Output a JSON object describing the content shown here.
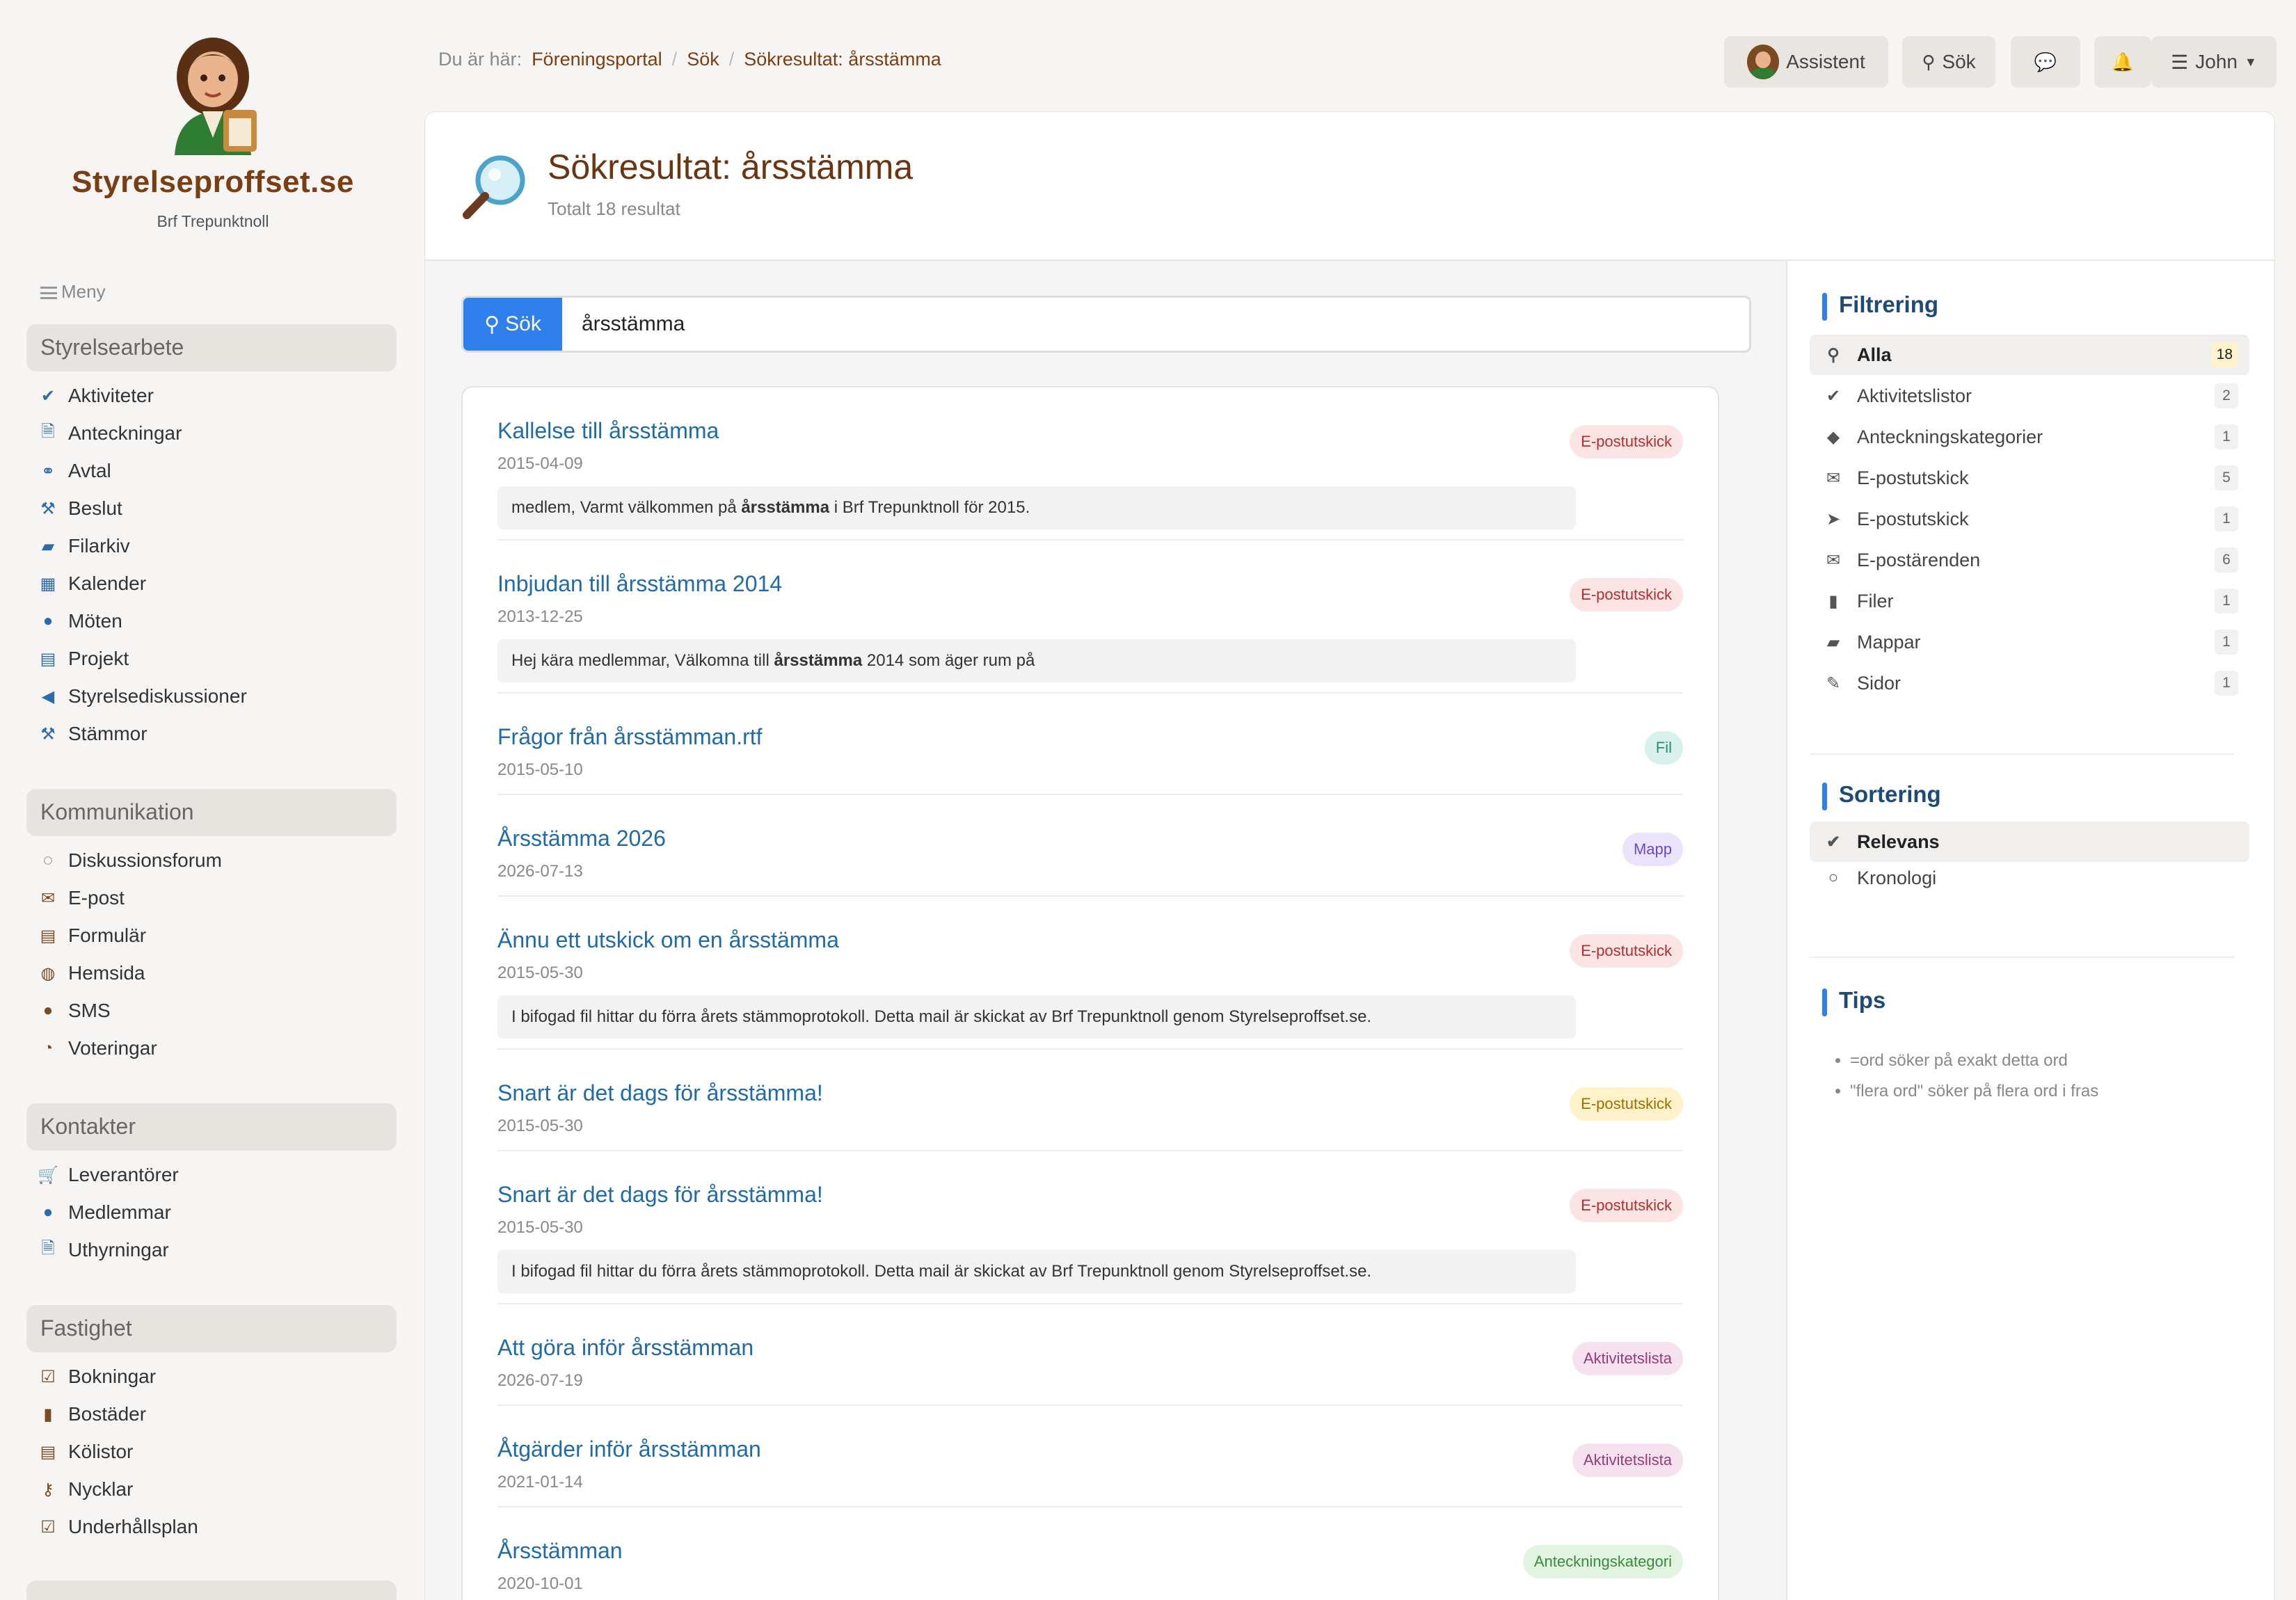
{
  "brand": {
    "name": "Styrelseproffset.se",
    "org": "Brf Trepunktnoll"
  },
  "menu_label": "Meny",
  "sidebar": [
    {
      "title": "Styrelsearbete",
      "items": [
        {
          "label": "Aktiviteter",
          "icon": "check-icon"
        },
        {
          "label": "Anteckningar",
          "icon": "document-icon"
        },
        {
          "label": "Avtal",
          "icon": "handshake-icon"
        },
        {
          "label": "Beslut",
          "icon": "gavel-icon"
        },
        {
          "label": "Filarkiv",
          "icon": "folder-open-icon"
        },
        {
          "label": "Kalender",
          "icon": "calendar-icon"
        },
        {
          "label": "Möten",
          "icon": "speech-bubble-icon"
        },
        {
          "label": "Projekt",
          "icon": "clipboard-icon"
        },
        {
          "label": "Styrelsediskussioner",
          "icon": "megaphone-icon"
        },
        {
          "label": "Stämmor",
          "icon": "gavel-icon"
        }
      ]
    },
    {
      "title": "Kommunikation",
      "items": [
        {
          "label": "Diskussionsforum",
          "icon": "chat-bubbles-icon"
        },
        {
          "label": "E-post",
          "icon": "envelope-icon"
        },
        {
          "label": "Formulär",
          "icon": "form-list-icon"
        },
        {
          "label": "Hemsida",
          "icon": "globe-icon"
        },
        {
          "label": "SMS",
          "icon": "sms-bubble-icon"
        },
        {
          "label": "Voteringar",
          "icon": "pie-chart-icon"
        }
      ]
    },
    {
      "title": "Kontakter",
      "items": [
        {
          "label": "Leverantörer",
          "icon": "cart-icon"
        },
        {
          "label": "Medlemmar",
          "icon": "user-icon"
        },
        {
          "label": "Uthyrningar",
          "icon": "document-icon"
        }
      ]
    },
    {
      "title": "Fastighet",
      "items": [
        {
          "label": "Bokningar",
          "icon": "calendar-check-icon"
        },
        {
          "label": "Bostäder",
          "icon": "building-icon"
        },
        {
          "label": "Kölistor",
          "icon": "list-icon"
        },
        {
          "label": "Nycklar",
          "icon": "key-icon"
        },
        {
          "label": "Underhållsplan",
          "icon": "calendar-check-icon"
        }
      ]
    }
  ],
  "breadcrumb": {
    "prefix": "Du är här:",
    "items": [
      "Föreningsportal",
      "Sök",
      "Sökresultat: årsstämma"
    ]
  },
  "topbar": {
    "assistant": "Assistent",
    "search": "Sök",
    "user": "John"
  },
  "page": {
    "title": "Sökresultat: årsstämma",
    "subtitle": "Totalt 18 resultat"
  },
  "search": {
    "button": "Sök",
    "value": "årsstämma"
  },
  "results": [
    {
      "title": "Kallelse till årsstämma",
      "date": "2015-04-09",
      "badge": "E-postutskick",
      "badge_color": "red",
      "snippet_pre": "medlem, Varmt välkommen på ",
      "snippet_bold": "årsstämma",
      "snippet_post": " i Brf Trepunktnoll för 2015."
    },
    {
      "title": "Inbjudan till årsstämma 2014",
      "date": "2013-12-25",
      "badge": "E-postutskick",
      "badge_color": "red",
      "snippet_pre": "Hej kära medlemmar, Välkomna till ",
      "snippet_bold": "årsstämma",
      "snippet_post": " 2014 som äger rum på"
    },
    {
      "title": "Frågor från årsstämman.rtf",
      "date": "2015-05-10",
      "badge": "Fil",
      "badge_color": "teal"
    },
    {
      "title": "Årsstämma 2026",
      "date": "2026-07-13",
      "badge": "Mapp",
      "badge_color": "purple"
    },
    {
      "title": "Ännu ett utskick om en årsstämma",
      "date": "2015-05-30",
      "badge": "E-postutskick",
      "badge_color": "red",
      "snippet_pre": "I bifogad fil hittar du förra årets stämmoprotokoll. Detta mail är skickat av Brf Trepunktnoll genom Styrelseproffset.se.",
      "snippet_bold": "",
      "snippet_post": ""
    },
    {
      "title": "Snart är det dags för årsstämma!",
      "date": "2015-05-30",
      "badge": "E-postutskick",
      "badge_color": "yellow"
    },
    {
      "title": "Snart är det dags för årsstämma!",
      "date": "2015-05-30",
      "badge": "E-postutskick",
      "badge_color": "red",
      "snippet_pre": "I bifogad fil hittar du förra årets stämmoprotokoll. Detta mail är skickat av Brf Trepunktnoll genom Styrelseproffset.se.",
      "snippet_bold": "",
      "snippet_post": ""
    },
    {
      "title": "Att göra inför årsstämman",
      "date": "2026-07-19",
      "badge": "Aktivitetslista",
      "badge_color": "pink"
    },
    {
      "title": "Åtgärder inför årsstämman",
      "date": "2021-01-14",
      "badge": "Aktivitetslista",
      "badge_color": "pink"
    },
    {
      "title": "Årsstämman",
      "date": "2020-10-01",
      "badge": "Anteckningskategori",
      "badge_color": "green"
    }
  ],
  "filter": {
    "title": "Filtrering",
    "items": [
      {
        "label": "Alla",
        "count": "18",
        "icon": "search-icon",
        "active": true
      },
      {
        "label": "Aktivitetslistor",
        "count": "2",
        "icon": "check-icon"
      },
      {
        "label": "Anteckningskategorier",
        "count": "1",
        "icon": "tags-icon"
      },
      {
        "label": "E-postutskick",
        "count": "5",
        "icon": "envelope-icon"
      },
      {
        "label": "E-postutskick",
        "count": "1",
        "icon": "paper-plane-icon"
      },
      {
        "label": "E-postärenden",
        "count": "6",
        "icon": "envelope-icon"
      },
      {
        "label": "Filer",
        "count": "1",
        "icon": "file-icon"
      },
      {
        "label": "Mappar",
        "count": "1",
        "icon": "folder-open-icon"
      },
      {
        "label": "Sidor",
        "count": "1",
        "icon": "edit-icon"
      }
    ]
  },
  "sorting": {
    "title": "Sortering",
    "items": [
      {
        "label": "Relevans",
        "icon": "check-icon",
        "active": true
      },
      {
        "label": "Kronologi",
        "icon": "circle-icon"
      }
    ]
  },
  "tips": {
    "title": "Tips",
    "items": [
      "=ord söker på exakt detta ord",
      "\"flera ord\" söker på flera ord i fras"
    ]
  }
}
